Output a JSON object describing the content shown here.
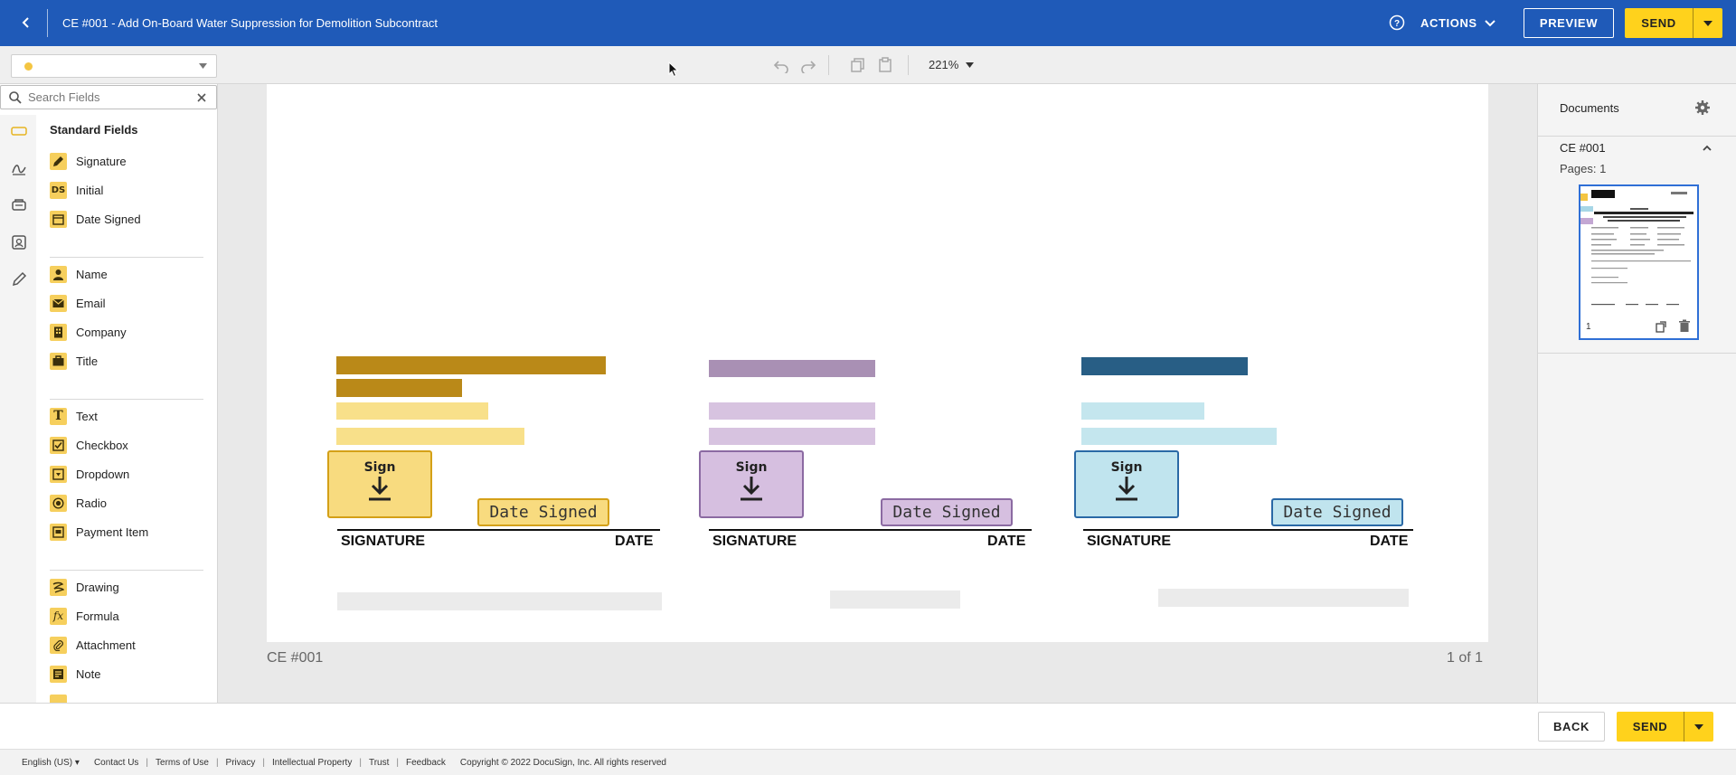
{
  "header": {
    "title": "CE #001 - Add On-Board Water Suppression for Demolition Subcontract",
    "actions_label": "ACTIONS",
    "preview_label": "PREVIEW",
    "send_label": "SEND",
    "brand_color": "#1f5ab8",
    "accent_color": "#ffd21c"
  },
  "toolbar": {
    "recipient_color": "#f4c542",
    "zoom": "221%",
    "icons": [
      "undo-icon",
      "redo-icon",
      "copy-icon",
      "paste-icon"
    ]
  },
  "left_panel": {
    "search_placeholder": "Search Fields",
    "rail_icons": [
      "standard-fields-icon",
      "signature-tools-icon",
      "stamp-icon",
      "custom-fields-icon",
      "pencil-icon"
    ],
    "heading": "Standard Fields",
    "groups": [
      [
        {
          "label": "Signature",
          "icon": "pen-icon"
        },
        {
          "label": "Initial",
          "icon": "ds-initial-icon"
        },
        {
          "label": "Date Signed",
          "icon": "calendar-icon"
        }
      ],
      [
        {
          "label": "Name",
          "icon": "person-icon"
        },
        {
          "label": "Email",
          "icon": "envelope-icon"
        },
        {
          "label": "Company",
          "icon": "building-icon"
        },
        {
          "label": "Title",
          "icon": "briefcase-icon"
        }
      ],
      [
        {
          "label": "Text",
          "icon": "text-t-icon"
        },
        {
          "label": "Checkbox",
          "icon": "checkbox-icon"
        },
        {
          "label": "Dropdown",
          "icon": "dropdown-icon"
        },
        {
          "label": "Radio",
          "icon": "radio-icon"
        },
        {
          "label": "Payment Item",
          "icon": "payment-icon"
        }
      ],
      [
        {
          "label": "Drawing",
          "icon": "drawing-icon"
        },
        {
          "label": "Formula",
          "icon": "formula-fx-icon"
        },
        {
          "label": "Attachment",
          "icon": "paperclip-icon"
        },
        {
          "label": "Note",
          "icon": "note-icon"
        }
      ]
    ]
  },
  "document": {
    "sign_label": "Sign",
    "date_signed_label": "Date Signed",
    "signature_caption": "SIGNATURE",
    "date_caption": "DATE",
    "signers": [
      {
        "fill": "#f8db7f",
        "border": "#d4a017",
        "dark": "#ba8918",
        "light": "#f8e08a"
      },
      {
        "fill": "#d6bfe0",
        "border": "#8b6aa2",
        "dark": "#a990b4",
        "light": "#d7c3e0"
      },
      {
        "fill": "#c0e4ee",
        "border": "#2a69a6",
        "dark": "#285e85",
        "light": "#c4e6ee"
      }
    ],
    "page_name": "CE #001",
    "page_count": "1 of 1"
  },
  "right_panel": {
    "title": "Documents",
    "doc_name": "CE #001",
    "pages": "Pages: 1",
    "thumb_page": "1"
  },
  "bottom_bar": {
    "back_label": "BACK",
    "send_label": "SEND"
  },
  "footer": {
    "language": "English (US)",
    "links": [
      "Contact Us",
      "Terms of Use",
      "Privacy",
      "Intellectual Property",
      "Trust",
      "Feedback"
    ],
    "copyright": "Copyright © 2022 DocuSign, Inc. All rights reserved"
  }
}
